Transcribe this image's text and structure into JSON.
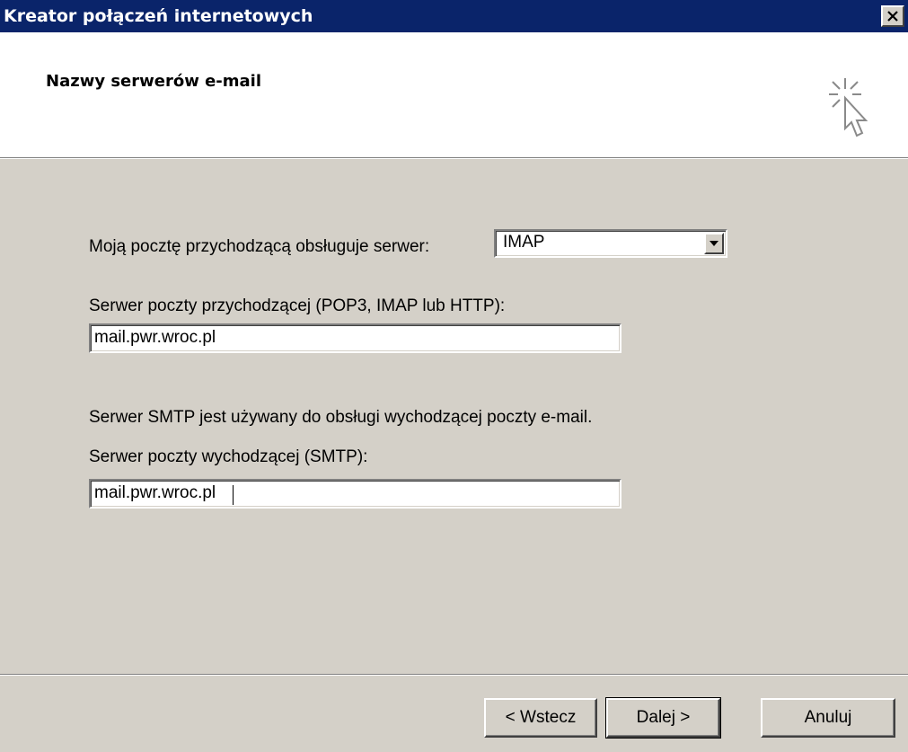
{
  "window": {
    "title": "Kreator połączeń internetowych",
    "close_icon": "close-icon"
  },
  "header": {
    "title": "Nazwy serwerów e-mail",
    "icon": "wizard-cursor-icon"
  },
  "incoming": {
    "type_label": "Moją pocztę przychodzącą obsługuje serwer:",
    "type_value": "IMAP",
    "type_options_visible": [
      "IMAP"
    ],
    "server_label": "Serwer poczty przychodzącej (POP3, IMAP lub HTTP):",
    "server_value": "mail.pwr.wroc.pl"
  },
  "outgoing": {
    "info_text": "Serwer SMTP jest używany do obsługi wychodzącej poczty e-mail.",
    "server_label": "Serwer poczty wychodzącej (SMTP):",
    "server_value": "mail.pwr.wroc.pl"
  },
  "buttons": {
    "back": "< Wstecz",
    "next": "Dalej >",
    "cancel": "Anuluj"
  },
  "colors": {
    "titlebar": "#0a246a",
    "dialog_face": "#d4d0c8",
    "header_bg": "#ffffff"
  }
}
